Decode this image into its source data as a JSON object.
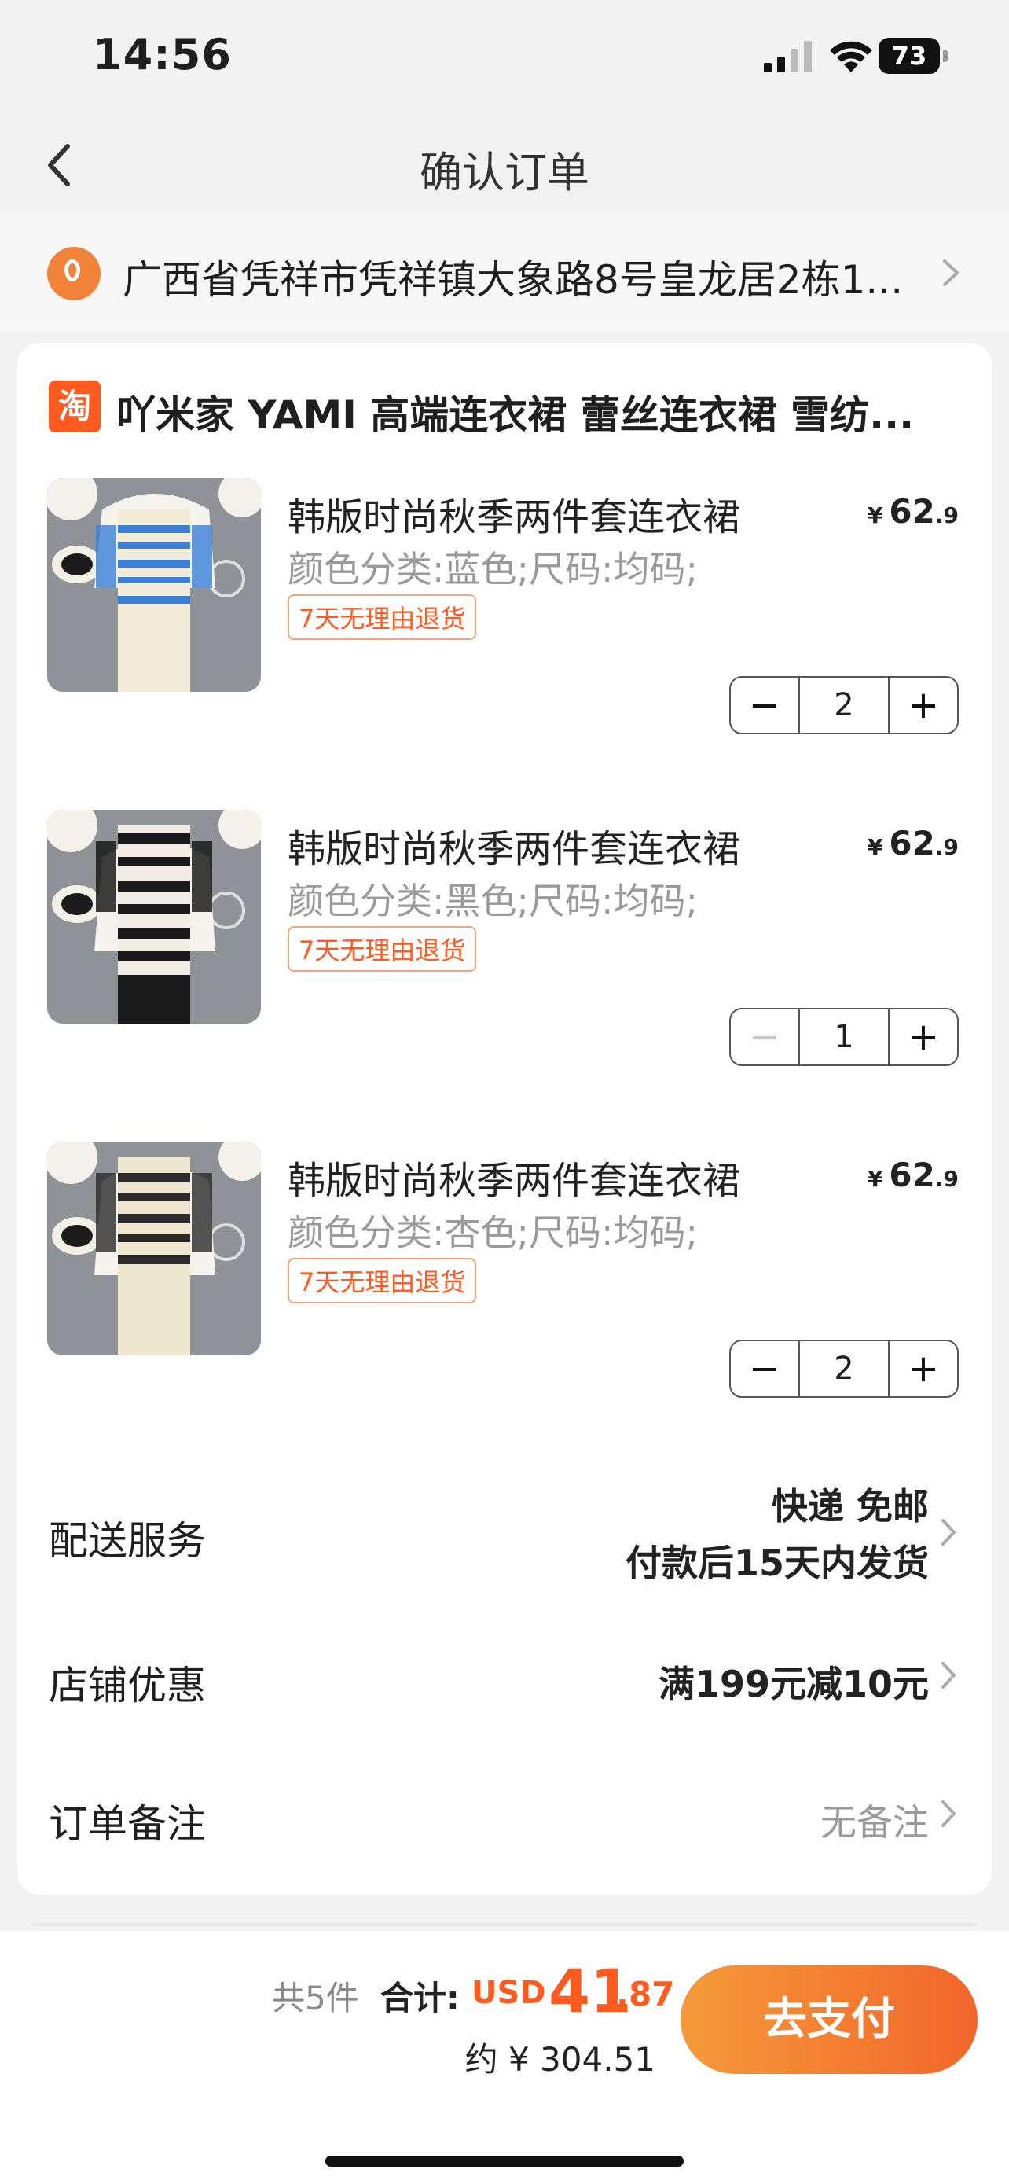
{
  "status": {
    "time": "14:56",
    "battery": "73"
  },
  "nav": {
    "title": "确认订单"
  },
  "address": {
    "text": "广西省凭祥市凭祥镇大象路8号皇龙居2栋1..."
  },
  "shop": {
    "logo": "淘",
    "name": "吖米家 YAMI 高端连衣裙 蕾丝连衣裙 雪纺..."
  },
  "items": [
    {
      "name": "韩版时尚秋季两件套连衣裙",
      "spec": "颜色分类:蓝色;尺码:均码;",
      "tag": "7天无理由退货",
      "currency": "¥",
      "price_int": "62",
      "price_dec": ".9",
      "qty": "2",
      "minus_disabled": false,
      "stripe_color": "#3a7fd8"
    },
    {
      "name": "韩版时尚秋季两件套连衣裙",
      "spec": "颜色分类:黑色;尺码:均码;",
      "tag": "7天无理由退货",
      "currency": "¥",
      "price_int": "62",
      "price_dec": ".9",
      "qty": "1",
      "minus_disabled": true,
      "stripe_color": "#1a1a1a"
    },
    {
      "name": "韩版时尚秋季两件套连衣裙",
      "spec": "颜色分类:杏色;尺码:均码;",
      "tag": "7天无理由退货",
      "currency": "¥",
      "price_int": "62",
      "price_dec": ".9",
      "qty": "2",
      "minus_disabled": false,
      "stripe_color": "#2b2b2b"
    }
  ],
  "delivery": {
    "label": "配送服务",
    "line1": "快递 免邮",
    "line2": "付款后15天内发货"
  },
  "discount": {
    "label": "店铺优惠",
    "value": "满199元减10元"
  },
  "note": {
    "label": "订单备注",
    "value": "无备注"
  },
  "footer": {
    "count": "共5件",
    "total_label": "合计:",
    "currency": "USD",
    "amount_int": "41",
    "amount_dec": ".87",
    "approx": "约 ¥ 304.51",
    "pay_label": "去支付"
  },
  "colors": {
    "accent": "#ff5a1f",
    "pay_gradient_start": "#f59a3a",
    "pay_gradient_end": "#f2662b"
  }
}
